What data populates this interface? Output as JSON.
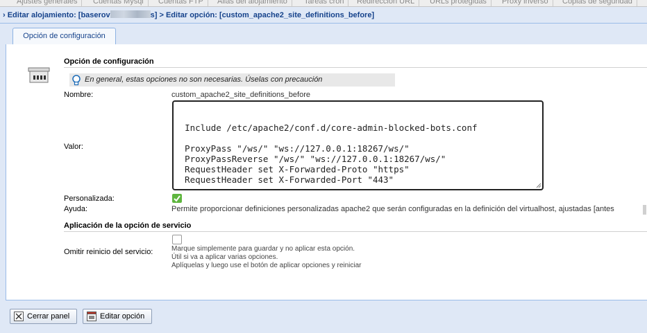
{
  "top_tabs": [
    "Ajustes generales",
    "Cuentas Mysql",
    "Cuentas FTP",
    "Alias del alojamiento",
    "Tareas cron",
    "Redirección URL",
    "URLs protegidas",
    "Proxy inverso",
    "Copias de seguridad"
  ],
  "header": {
    "prefix": "› Editar alojamiento: [baserov",
    "suffix": "s] > Editar opción: [custom_apache2_site_definitions_before]"
  },
  "tab": {
    "label": "Opción de configuración"
  },
  "section1": {
    "title": "Opción de configuración",
    "hint": "En general, estas opciones no son necesarias. Úselas con precaución"
  },
  "fields": {
    "nombre_label": "Nombre:",
    "nombre_value": "custom_apache2_site_definitions_before",
    "valor_label": "Valor:",
    "valor_value": "Include /etc/apache2/conf.d/core-admin-blocked-bots.conf\n\n  ProxyPass \"/ws/\" \"ws://127.0.0.1:18267/ws/\"\n  ProxyPassReverse \"/ws/\" \"ws://127.0.0.1:18267/ws/\"\n  RequestHeader set X-Forwarded-Proto \"https\"\n  RequestHeader set X-Forwarded-Port \"443\"",
    "personalizada_label": "Personalizada:",
    "personalizada_checked": true,
    "ayuda_label": "Ayuda:",
    "ayuda_value": "Permite proporcionar definiciones personalizadas apache2 que serán configuradas en la definición del virtualhost, ajustadas [antes"
  },
  "section2": {
    "title": "Aplicación de la opción de servicio",
    "omitir_label": "Omitir reinicio del servicio:",
    "omitir_checked": false,
    "note1": "Marque simplemente para guardar y no aplicar esta opción.",
    "note2": "Útil si va a aplicar varias opciones.",
    "note3": "Aplíquelas y luego use el botón de aplicar opciones y reiniciar"
  },
  "footer": {
    "close_label": "Cerrar panel",
    "edit_label": "Editar opción"
  },
  "colors": {
    "background": "#dfe8f6",
    "header_text": "#15428b",
    "check_green": "#5fb63f"
  },
  "icons": [
    "server-icon",
    "lightbulb-icon",
    "check-icon",
    "close-icon",
    "edit-icon"
  ]
}
